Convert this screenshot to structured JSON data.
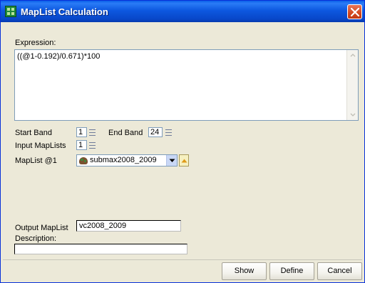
{
  "window": {
    "title": "MapList Calculation"
  },
  "icons": {
    "app": "maplist-app-icon",
    "close": "close-icon",
    "scroll_up": "scroll-up-icon",
    "scroll_down": "scroll-down-icon",
    "dropdown": "chevron-down-icon",
    "browse": "browse-up-icon",
    "maplist": "maplist-icon"
  },
  "expression": {
    "label": "Expression:",
    "value": "((@1-0.192)/0.671)*100"
  },
  "bands": {
    "start_label": "Start Band",
    "start_value": "1",
    "end_label": "End Band",
    "end_value": "24"
  },
  "input_maplists": {
    "label": "Input MapLists",
    "value": "1"
  },
  "maplist1": {
    "label": "MapList @1",
    "value": "submax2008_2009"
  },
  "output_maplist": {
    "label": "Output MapList",
    "value": "vc2008_2009"
  },
  "description": {
    "label": "Description:",
    "value": ""
  },
  "buttons": {
    "show": "Show",
    "define": "Define",
    "cancel": "Cancel"
  },
  "colors": {
    "titlebar": "#0a5fe8",
    "close": "#d2481f",
    "window_bg": "#ece9d8",
    "border": "#7f9db9"
  }
}
